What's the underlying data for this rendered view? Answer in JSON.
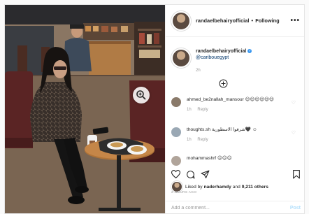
{
  "post": {
    "username": "randaelbehairyofficial",
    "separator": "•",
    "follow_label": "Following",
    "more_label": "•••",
    "caption_username": "randaelbehairyofficial",
    "caption_mention": "@caribouegypt",
    "caption_time": "2h",
    "verified_mark": "✓"
  },
  "comments": [
    {
      "user": "ahmed_be2nallah_mansour",
      "text": "😊😊😊😊😊😊",
      "time": "1h",
      "reply": "Reply",
      "avatar_color": "#8a7a6a"
    },
    {
      "user": "thoughts.sh",
      "text": "شرفوا الاسطورية🖤 ☺",
      "time": "1h",
      "reply": "Reply",
      "avatar_color": "#9aa8b4"
    },
    {
      "user": "mohammashrf",
      "text": "😊😊😊",
      "avatar_color": "#b0a49a"
    }
  ],
  "likes": {
    "prefix": "Liked by",
    "user": "naderhamdy",
    "and": "and",
    "count": "9,211 others"
  },
  "time_ago": "2 HOURS AGO",
  "add_comment": {
    "placeholder": "Add a comment...",
    "post_label": "Post"
  },
  "colors": {
    "link": "#003569",
    "post_disabled": "#b2dffc",
    "verified": "#3897f0"
  },
  "icons": [
    "zoom-in-icon",
    "heart-icon",
    "comment-icon",
    "share-icon",
    "bookmark-icon",
    "more-options-icon",
    "add-comment-icon",
    "verified-icon"
  ]
}
